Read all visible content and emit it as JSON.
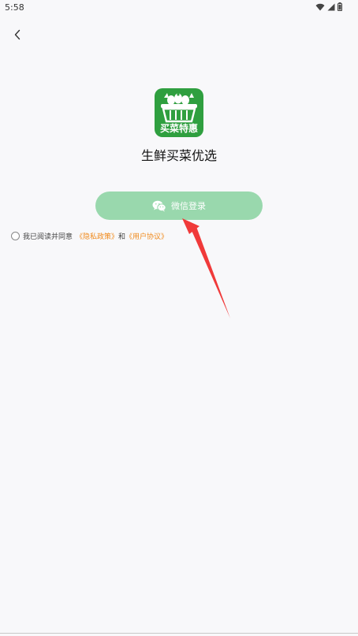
{
  "status_bar": {
    "time": "5:58"
  },
  "app": {
    "logo_text": "买菜特惠",
    "name": "生鲜买菜优选"
  },
  "login": {
    "wechat_label": "微信登录"
  },
  "agreement": {
    "prefix": "我已阅读并同意",
    "privacy_link": "《隐私政策》",
    "connector": "和",
    "terms_link": "《用户协议》"
  },
  "colors": {
    "button_bg": "#99d8ad",
    "logo_bg": "#2f9f3f",
    "link": "#f08a1c",
    "arrow": "#f03a3a"
  },
  "icons": [
    "wifi-icon",
    "signal-icon",
    "battery-icon",
    "back-arrow-icon",
    "wechat-icon",
    "basket-icon"
  ]
}
